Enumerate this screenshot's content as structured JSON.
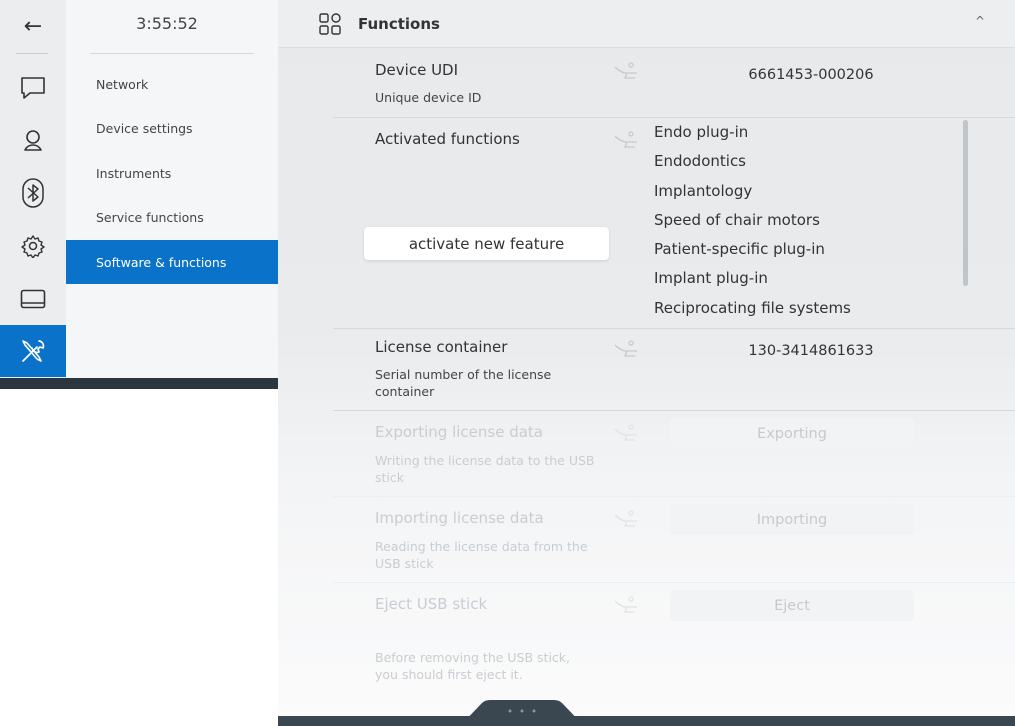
{
  "colors": {
    "accent": "#0a72c9",
    "rail_bg": "#ebedee",
    "dark_bar": "#2b3640"
  },
  "rail": {
    "items": [
      {
        "icon": "back-arrow-icon"
      },
      {
        "icon": "chat-icon"
      },
      {
        "icon": "user-icon"
      },
      {
        "icon": "bluetooth-icon"
      },
      {
        "icon": "gear-icon"
      },
      {
        "icon": "display-icon"
      },
      {
        "icon": "tools-icon",
        "active": true
      }
    ]
  },
  "menu": {
    "clock": "3:55:52",
    "items": [
      {
        "label": "Network"
      },
      {
        "label": "Device settings"
      },
      {
        "label": "Instruments"
      },
      {
        "label": "Service functions"
      },
      {
        "label": "Software & functions",
        "active": true
      }
    ]
  },
  "header": {
    "title": "Functions",
    "icon": "grid-icon",
    "caret": "^"
  },
  "rows": {
    "udi": {
      "title": "Device UDI",
      "subtitle": "Unique device ID",
      "value": "6661453-000206"
    },
    "activated": {
      "title": "Activated functions",
      "button": "activate new feature",
      "functions": [
        "Endo plug-in",
        "Endodontics",
        "Implantology",
        "Speed of chair motors",
        "Patient-specific plug-in",
        "Implant plug-in",
        "Reciprocating file systems"
      ]
    },
    "license": {
      "title": "License container",
      "subtitle": "Serial number of the license container",
      "value": "130-3414861633"
    },
    "export": {
      "title": "Exporting license data",
      "subtitle": "Writing the license data to the USB stick",
      "button": "Exporting"
    },
    "import": {
      "title": "Importing license data",
      "subtitle": "Reading the license data from the USB stick",
      "button": "Importing"
    },
    "eject": {
      "title": "Eject USB stick",
      "subtitle": "Before removing the USB stick, you should first eject it.",
      "button": "Eject"
    }
  }
}
